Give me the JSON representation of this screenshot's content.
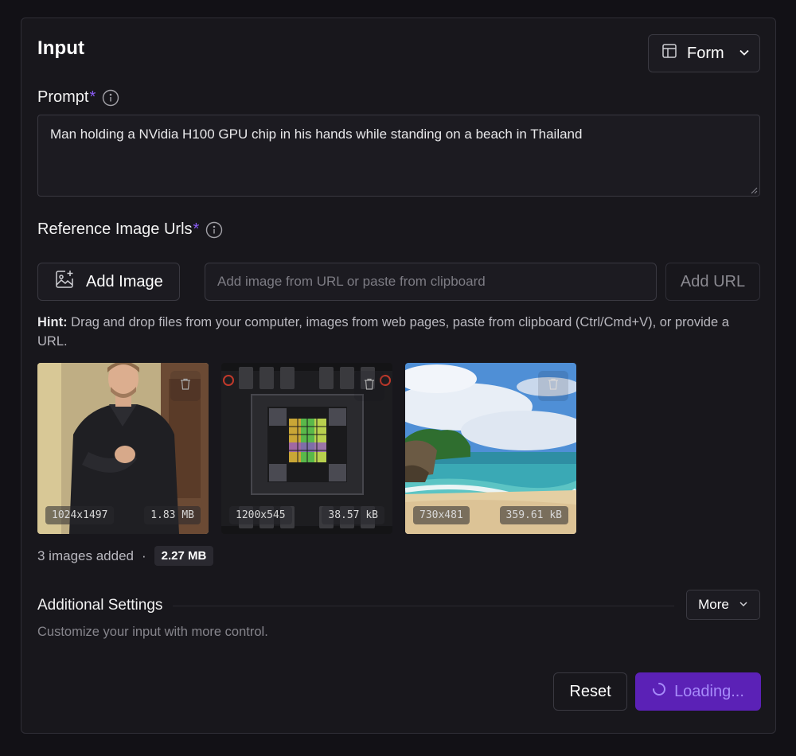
{
  "panel": {
    "title": "Input",
    "view_selector": {
      "label": "Form"
    }
  },
  "prompt": {
    "label": "Prompt",
    "required_mark": "*",
    "value": "Man holding a NVidia H100 GPU chip in his hands while standing on a beach in Thailand"
  },
  "reference_images": {
    "label": "Reference Image Urls",
    "required_mark": "*",
    "add_image_label": "Add Image",
    "url_placeholder": "Add image from URL or paste from clipboard",
    "add_url_label": "Add URL",
    "hint_prefix": "Hint:",
    "hint_text": " Drag and drop files from your computer, images from web pages, paste from clipboard (Ctrl/Cmd+V), or provide a URL.",
    "images": [
      {
        "dimensions": "1024x1497",
        "size": "1.83 MB"
      },
      {
        "dimensions": "1200x545",
        "size": "38.57 kB"
      },
      {
        "dimensions": "730x481",
        "size": "359.61 kB"
      }
    ],
    "count_text": "3 images added",
    "separator": "·",
    "total_size": "2.27 MB"
  },
  "additional_settings": {
    "title": "Additional Settings",
    "description": "Customize your input with more control.",
    "more_label": "More"
  },
  "actions": {
    "reset_label": "Reset",
    "submit_label": "Loading..."
  },
  "colors": {
    "accent": "#5b21b6",
    "required": "#8b5cf6",
    "background": "#121116"
  },
  "icons": {
    "view": "layout-icon",
    "info": "info-icon",
    "add_image": "image-plus-icon",
    "delete": "trash-icon",
    "dropdown": "chevron-down-icon",
    "spinner": "spinner-icon"
  }
}
